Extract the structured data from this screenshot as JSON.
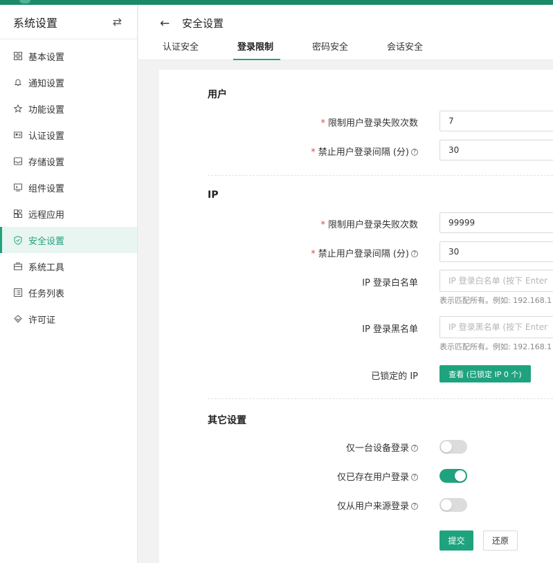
{
  "sidebar": {
    "title": "系统设置",
    "items": [
      {
        "label": "基本设置",
        "icon": "grid-icon"
      },
      {
        "label": "通知设置",
        "icon": "bell-icon"
      },
      {
        "label": "功能设置",
        "icon": "star-icon"
      },
      {
        "label": "认证设置",
        "icon": "id-card-icon"
      },
      {
        "label": "存储设置",
        "icon": "inbox-icon"
      },
      {
        "label": "组件设置",
        "icon": "monitor-icon"
      },
      {
        "label": "远程应用",
        "icon": "apps-icon"
      },
      {
        "label": "安全设置",
        "icon": "shield-icon",
        "active": true
      },
      {
        "label": "系统工具",
        "icon": "toolbox-icon"
      },
      {
        "label": "任务列表",
        "icon": "list-icon"
      },
      {
        "label": "许可证",
        "icon": "diamond-icon"
      }
    ]
  },
  "header": {
    "title": "安全设置",
    "tabs": [
      {
        "label": "认证安全"
      },
      {
        "label": "登录限制",
        "active": true
      },
      {
        "label": "密码安全"
      },
      {
        "label": "会话安全"
      }
    ]
  },
  "form": {
    "user_section": {
      "title": "用户",
      "fail_limit_label": "限制用户登录失败次数",
      "fail_limit_value": "7",
      "block_interval_label": "禁止用户登录间隔 (分)",
      "block_interval_value": "30"
    },
    "ip_section": {
      "title": "IP",
      "fail_limit_label": "限制用户登录失败次数",
      "fail_limit_value": "99999",
      "block_interval_label": "禁止用户登录间隔 (分)",
      "block_interval_value": "30",
      "whitelist_label": "IP 登录白名单",
      "whitelist_placeholder": "IP 登录白名单 (按下 Enter",
      "whitelist_hint": "表示匹配所有。例如: 192.168.1",
      "blacklist_label": "IP 登录黑名单",
      "blacklist_placeholder": "IP 登录黑名单 (按下 Enter",
      "blacklist_hint": "表示匹配所有。例如: 192.168.1",
      "locked_label": "已锁定的 IP",
      "locked_button": "查看 (已锁定 IP 0 个)"
    },
    "other_section": {
      "title": "其它设置",
      "single_device_label": "仅一台设备登录",
      "single_device_on": false,
      "existing_user_label": "仅已存在用户登录",
      "existing_user_on": true,
      "user_source_label": "仅从用户来源登录",
      "user_source_on": false
    },
    "submit_label": "提交",
    "reset_label": "还原"
  },
  "colors": {
    "accent": "#1fa37e",
    "topbar": "#1a8a6a",
    "required": "#e0484c"
  }
}
